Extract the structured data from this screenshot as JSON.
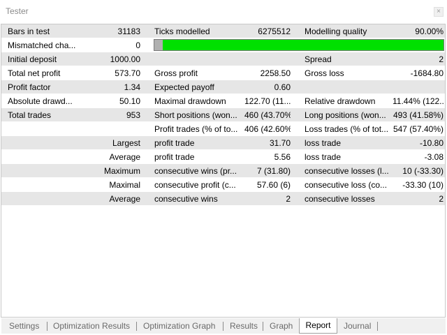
{
  "window": {
    "title": "Tester",
    "close_symbol": "×"
  },
  "report": {
    "rows": [
      {
        "style": "shade",
        "l1": "Bars in test",
        "v1": "31183",
        "l2": "Ticks modelled",
        "v2": "6275512",
        "l3": "Modelling quality",
        "v3": "90.00%"
      },
      {
        "style": "white",
        "l1": "Mismatched cha...",
        "v1": "0",
        "progress": true
      },
      {
        "style": "shade",
        "l1": "Initial deposit",
        "v1": "1000.00",
        "l2": "",
        "v2": "",
        "l3": "Spread",
        "v3": "2"
      },
      {
        "style": "white",
        "l1": "Total net profit",
        "v1": "573.70",
        "l2": "Gross profit",
        "v2": "2258.50",
        "l3": "Gross loss",
        "v3": "-1684.80"
      },
      {
        "style": "shade",
        "l1": "Profit factor",
        "v1": "1.34",
        "l2": "Expected payoff",
        "v2": "0.60",
        "l3": "",
        "v3": ""
      },
      {
        "style": "white",
        "l1": "Absolute drawd...",
        "v1": "50.10",
        "l2": "Maximal drawdown",
        "v2": "122.70 (11....",
        "l3": "Relative drawdown",
        "v3": "11.44% (122...."
      },
      {
        "style": "shade",
        "l1": "Total trades",
        "v1": "953",
        "l2": "Short positions (won...",
        "v2": "460 (43.70%)",
        "l3": "Long positions (won...",
        "v3": "493 (41.58%)"
      },
      {
        "style": "white",
        "wl1": "",
        "l2": "Profit trades (% of to...",
        "v2": "406 (42.60%)",
        "l3": "Loss trades (% of tot...",
        "v3": "547 (57.40%)"
      },
      {
        "style": "shade",
        "wl1": "Largest",
        "l2": "profit trade",
        "v2": "31.70",
        "l3": "loss trade",
        "v3": "-10.80"
      },
      {
        "style": "white",
        "wl1": "Average",
        "l2": "profit trade",
        "v2": "5.56",
        "l3": "loss trade",
        "v3": "-3.08"
      },
      {
        "style": "shade",
        "wl1": "Maximum",
        "l2": "consecutive wins (pr...",
        "v2": "7 (31.80)",
        "l3": "consecutive losses (l...",
        "v3": "10 (-33.30)"
      },
      {
        "style": "white",
        "wl1": "Maximal",
        "l2": "consecutive profit (c...",
        "v2": "57.60 (6)",
        "l3": "consecutive loss (co...",
        "v3": "-33.30 (10)"
      },
      {
        "style": "shade",
        "wl1": "Average",
        "l2": "consecutive wins",
        "v2": "2",
        "l3": "consecutive losses",
        "v3": "2"
      }
    ],
    "progress": {
      "thumb_fraction": 0.03,
      "fill_fraction": 0.97,
      "fill_color": "#00e000"
    }
  },
  "tabs": [
    {
      "label": "Settings",
      "name": "tab-settings",
      "active": false
    },
    {
      "label": "Optimization Results",
      "name": "tab-optimization-results",
      "active": false
    },
    {
      "label": "Optimization Graph",
      "name": "tab-optimization-graph",
      "active": false
    },
    {
      "label": "Results",
      "name": "tab-results",
      "active": false
    },
    {
      "label": "Graph",
      "name": "tab-graph",
      "active": false
    },
    {
      "label": "Report",
      "name": "tab-report",
      "active": true
    },
    {
      "label": "Journal",
      "name": "tab-journal",
      "active": false
    }
  ]
}
